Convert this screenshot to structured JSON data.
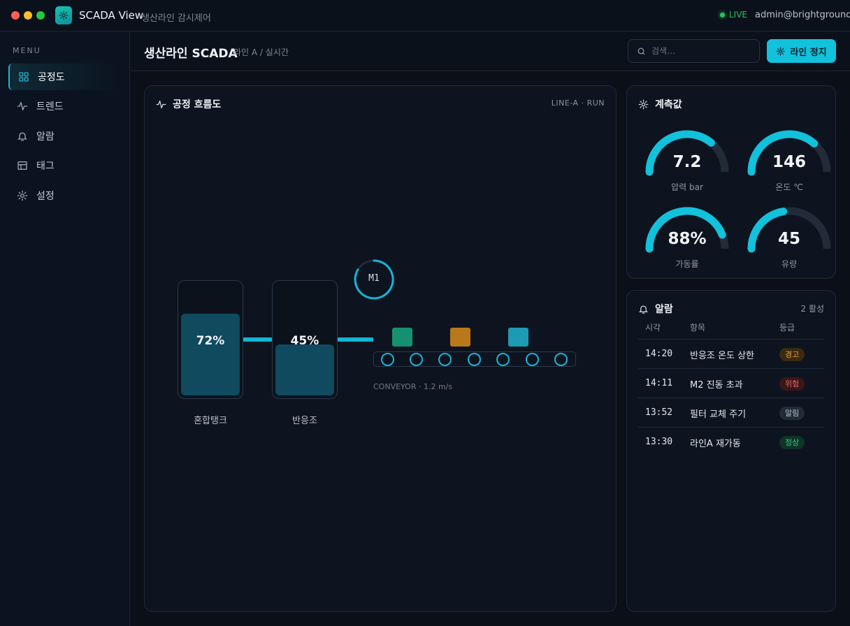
{
  "titlebar": {
    "app_name": "SCADA View",
    "app_subtitle": "생산라인 감시제어",
    "live_label": "LIVE",
    "user": "admin@brightground"
  },
  "sidebar": {
    "menu_label": "MENU",
    "items": [
      {
        "label": "공정도",
        "icon": "grid-icon",
        "active": true
      },
      {
        "label": "트렌드",
        "icon": "pulse-icon",
        "active": false
      },
      {
        "label": "알람",
        "icon": "bell-icon",
        "active": false
      },
      {
        "label": "태그",
        "icon": "table-icon",
        "active": false
      },
      {
        "label": "설정",
        "icon": "gear-icon",
        "active": false
      }
    ]
  },
  "header": {
    "title": "생산라인 SCADA",
    "breadcrumb": "라인 A / 실시간",
    "search_placeholder": "검색…",
    "stop_button": "라인 정지"
  },
  "flow": {
    "title": "공정 흐름도",
    "line_code": "LINE-A · RUN",
    "tanks": [
      {
        "name": "혼합탱크",
        "value": "72%",
        "level": 0.72
      },
      {
        "name": "반응조",
        "value": "45%",
        "level": 0.45
      }
    ],
    "motor": "M1",
    "conveyor_label": "CONVEYOR · 1.2 m/s",
    "box_colors": [
      "#16916f",
      "#b9791a",
      "#1d9ab4"
    ]
  },
  "gauges": {
    "title": "계측값",
    "items": [
      {
        "value": "7.2",
        "label": "압력 bar",
        "fraction": 0.72
      },
      {
        "value": "146",
        "label": "온도 ℃",
        "fraction": 0.73
      },
      {
        "value": "88%",
        "label": "가동률",
        "fraction": 0.88
      },
      {
        "value": "45",
        "label": "유량",
        "fraction": 0.45
      }
    ]
  },
  "alarms": {
    "title": "알람",
    "active_count": "2 활성",
    "columns": [
      "시각",
      "항목",
      "등급"
    ],
    "rows": [
      {
        "time": "14:20",
        "item": "반응조 온도 상한",
        "level": "경고",
        "level_color": "#e0a640",
        "level_bg": "#3a2a10"
      },
      {
        "time": "14:11",
        "item": "M2 진동 초과",
        "level": "위험",
        "level_color": "#f06a6a",
        "level_bg": "#3a1618"
      },
      {
        "time": "13:52",
        "item": "필터 교체 주기",
        "level": "알림",
        "level_color": "#b6c0cb",
        "level_bg": "#222c39"
      },
      {
        "time": "13:30",
        "item": "라인A 재가동",
        "level": "정상",
        "level_color": "#35c98a",
        "level_bg": "#0f3326"
      }
    ]
  },
  "colors": {
    "accent": "#12c1db",
    "live": "#22c55e"
  }
}
